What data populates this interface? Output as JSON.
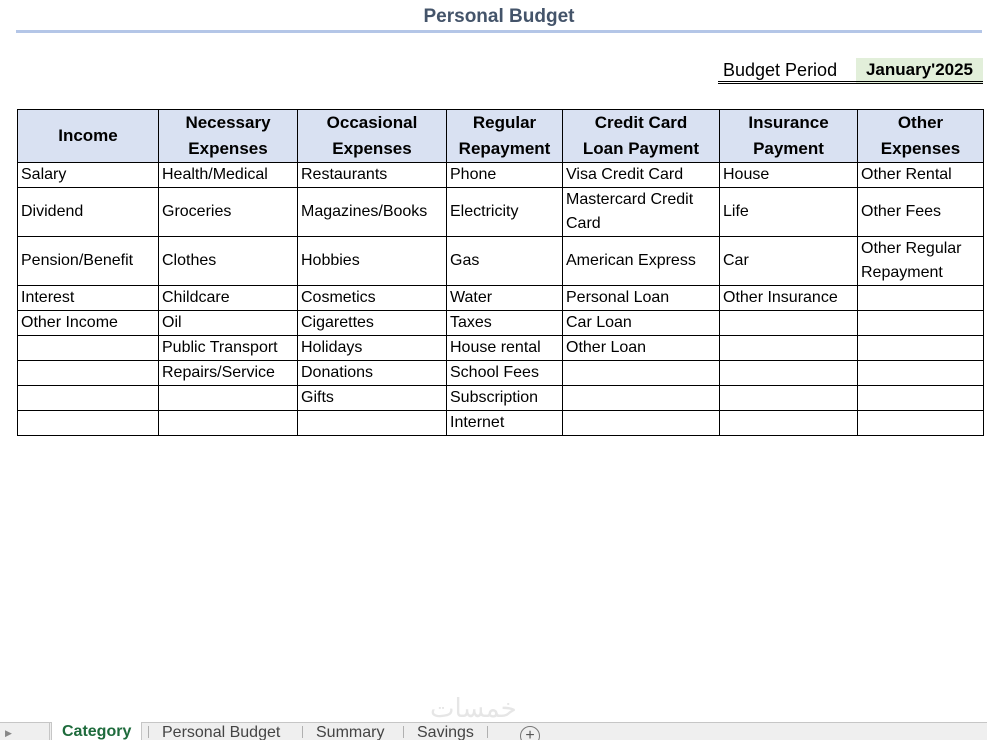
{
  "sheet_title": "Personal Budget",
  "budget_period": {
    "label": "Budget Period",
    "value": "January'2025"
  },
  "table": {
    "headers": [
      [
        "Income"
      ],
      [
        "Necessary",
        "Expenses"
      ],
      [
        "Occasional",
        "Expenses"
      ],
      [
        "Regular",
        "Repayment"
      ],
      [
        "Credit Card",
        "Loan Payment"
      ],
      [
        "Insurance",
        "Payment"
      ],
      [
        "Other",
        "Expenses"
      ]
    ],
    "rows": [
      [
        "Salary",
        "Health/Medical",
        "Restaurants",
        "Phone",
        "Visa Credit Card",
        "House",
        "Other Rental"
      ],
      [
        "Dividend",
        "Groceries",
        "Magazines/Books",
        "Electricity",
        "Mastercard Credit Card",
        "Life",
        "Other Fees"
      ],
      [
        "Pension/Benefit",
        "Clothes",
        "Hobbies",
        "Gas",
        "American Express",
        "Car",
        "Other Regular Repayment"
      ],
      [
        "Interest",
        "Childcare",
        "Cosmetics",
        "Water",
        "Personal Loan",
        "Other Insurance",
        ""
      ],
      [
        "Other Income",
        "Oil",
        "Cigarettes",
        "Taxes",
        "Car Loan",
        "",
        ""
      ],
      [
        "",
        "Public Transport",
        "Holidays",
        "House rental",
        "Other Loan",
        "",
        ""
      ],
      [
        "",
        "Repairs/Service",
        "Donations",
        "School Fees",
        "",
        "",
        ""
      ],
      [
        "",
        "",
        "Gifts",
        "Subscription",
        "",
        "",
        ""
      ],
      [
        "",
        "",
        "",
        "Internet",
        "",
        "",
        ""
      ]
    ]
  },
  "sheet_tabs": [
    "Category",
    "Personal Budget",
    "Summary",
    "Savings"
  ],
  "active_tab": "Category",
  "watermark": "خمسات",
  "icons": {
    "add_sheet": "plus-circle-icon",
    "nav": "scroll-left-icon"
  },
  "colors": {
    "header_fill": "#d9e1f2",
    "period_fill": "#e2efda",
    "title": "#44546a",
    "active_tab": "#1e6b3c"
  }
}
